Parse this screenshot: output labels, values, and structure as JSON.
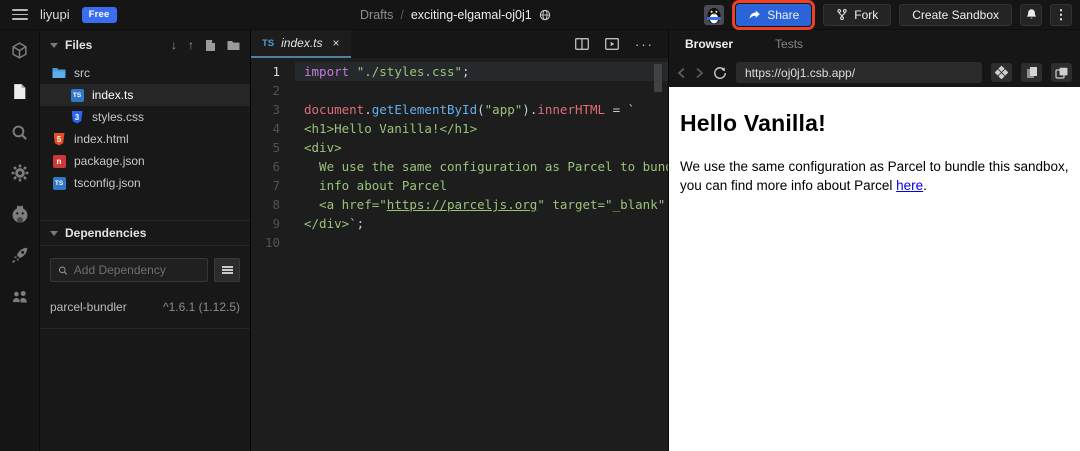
{
  "topbar": {
    "user": "liyupi",
    "plan_badge": "Free",
    "breadcrumb": {
      "root": "Drafts",
      "separator": "/",
      "title": "exciting-elgamal-oj0j1"
    },
    "share_label": "Share",
    "fork_label": "Fork",
    "create_label": "Create Sandbox",
    "highlight_color": "#ec4127",
    "share_color": "#2b63d9"
  },
  "sidebar": {
    "icons": [
      "sandbox-info",
      "file-explorer",
      "search",
      "settings",
      "github",
      "deployment",
      "live-collaboration"
    ]
  },
  "files": {
    "title": "Files",
    "tree": [
      {
        "name": "src",
        "type": "folder"
      },
      {
        "name": "index.ts",
        "type": "typescript",
        "selected": true
      },
      {
        "name": "styles.css",
        "type": "css"
      },
      {
        "name": "index.html",
        "type": "html"
      },
      {
        "name": "package.json",
        "type": "npm"
      },
      {
        "name": "tsconfig.json",
        "type": "typescript"
      }
    ],
    "icon_labels": {
      "ts": "TS",
      "css": "3",
      "html": "5",
      "npm": "n"
    },
    "dependencies": {
      "title": "Dependencies",
      "search_placeholder": "Add Dependency",
      "items": [
        {
          "name": "parcel-bundler",
          "version": "^1.6.1 (1.12.5)"
        }
      ]
    }
  },
  "editor": {
    "tab": {
      "lang": "TS",
      "name": "index.ts",
      "close": "×"
    },
    "code": {
      "lines": [
        {
          "n": "1",
          "active": true,
          "tokens": [
            {
              "t": "import",
              "c": "kw"
            },
            {
              "t": " ",
              "c": "pln"
            },
            {
              "t": "\"./styles.css\"",
              "c": "str"
            },
            {
              "t": ";",
              "c": "pln"
            }
          ]
        },
        {
          "n": "2",
          "tokens": []
        },
        {
          "n": "3",
          "tokens": [
            {
              "t": "document",
              "c": "var"
            },
            {
              "t": ".",
              "c": "pln"
            },
            {
              "t": "getElementById",
              "c": "fn"
            },
            {
              "t": "(",
              "c": "pln"
            },
            {
              "t": "\"app\"",
              "c": "str"
            },
            {
              "t": ")",
              "c": "pln"
            },
            {
              "t": ".",
              "c": "pln"
            },
            {
              "t": "innerHTML",
              "c": "var"
            },
            {
              "t": " = ",
              "c": "pln"
            },
            {
              "t": "`",
              "c": "pln"
            }
          ]
        },
        {
          "n": "4",
          "tokens": [
            {
              "t": "<h1>Hello Vanilla!</h1>",
              "c": "str"
            }
          ]
        },
        {
          "n": "5",
          "tokens": [
            {
              "t": "<div>",
              "c": "str"
            }
          ]
        },
        {
          "n": "6",
          "tokens": [
            {
              "t": "  We use the same configuration as Parcel to bundle this sandbox, you can find more",
              "c": "str"
            }
          ]
        },
        {
          "n": "7",
          "tokens": [
            {
              "t": "  info about Parcel",
              "c": "str"
            }
          ]
        },
        {
          "n": "8",
          "tokens": [
            {
              "t": "  <a href=\"",
              "c": "str"
            },
            {
              "t": "https://parceljs.org",
              "c": "stru"
            },
            {
              "t": "\" target=\"_blank\" rel=\"noopener noreferrer\">here</a>.",
              "c": "str"
            }
          ]
        },
        {
          "n": "9",
          "tokens": [
            {
              "t": "</div>",
              "c": "str"
            },
            {
              "t": "`;",
              "c": "pln"
            }
          ]
        },
        {
          "n": "10",
          "tokens": []
        }
      ]
    }
  },
  "browser": {
    "tabs": {
      "browser": "Browser",
      "tests": "Tests"
    },
    "url": "https://oj0j1.csb.app/",
    "preview": {
      "heading": "Hello Vanilla!",
      "body_before": "We use the same configuration as Parcel to bundle this sandbox, you can find more info about Parcel ",
      "link_text": "here",
      "body_after": "."
    }
  }
}
